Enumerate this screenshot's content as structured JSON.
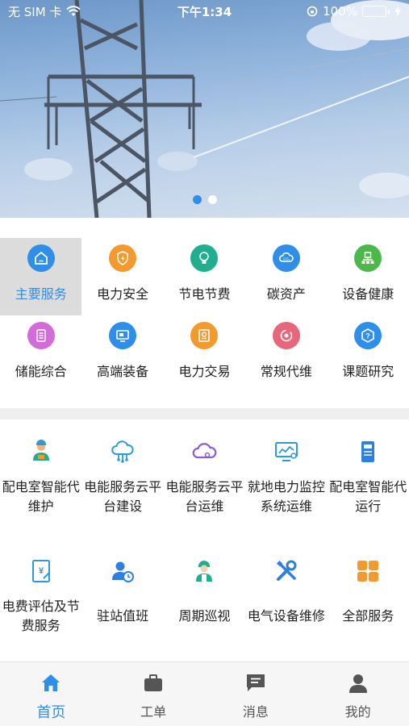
{
  "status_bar": {
    "carrier": "无 SIM 卡",
    "time": "下午1:34",
    "battery": "100%",
    "wifi_icon": "wifi-icon",
    "charging_icon": "charging-icon",
    "lock_icon": "orientation-lock-icon"
  },
  "banner": {
    "image": "power-transmission-tower-photo",
    "page_count": 2,
    "active_page": 1
  },
  "categories": [
    {
      "label": "主要服务",
      "icon": "home-icon",
      "color": "#2f8ee8",
      "selected": true
    },
    {
      "label": "电力安全",
      "icon": "lightning-shield-icon",
      "color": "#f39a2e"
    },
    {
      "label": "节电节费",
      "icon": "bulb-icon",
      "color": "#1fae8e"
    },
    {
      "label": "碳资产",
      "icon": "co2-cloud-icon",
      "color": "#2f8ee8"
    },
    {
      "label": "设备健康",
      "icon": "device-network-icon",
      "color": "#4cb84a"
    },
    {
      "label": "储能综合",
      "icon": "battery-storage-icon",
      "color": "#d36bd8"
    },
    {
      "label": "高端装备",
      "icon": "equipment-icon",
      "color": "#2f8ee8"
    },
    {
      "label": "电力交易",
      "icon": "trade-icon",
      "color": "#f39a2e"
    },
    {
      "label": "常规代维",
      "icon": "maintenance-cycle-icon",
      "color": "#e8667a"
    },
    {
      "label": "课题研究",
      "icon": "research-question-icon",
      "color": "#2f8ee8"
    }
  ],
  "services": [
    {
      "label": "配电室智能代维护",
      "icon": "engineer-icon",
      "color": "#2e9bd6"
    },
    {
      "label": "电能服务云平台建设",
      "icon": "cloud-network-icon",
      "color": "#2e9bd6"
    },
    {
      "label": "电能服务云平台运维",
      "icon": "cloud-icon",
      "color": "#8e5bd6"
    },
    {
      "label": "就地电力监控系统运维",
      "icon": "monitor-chart-icon",
      "color": "#2e9bd6"
    },
    {
      "label": "配电室智能代运行",
      "icon": "meter-icon",
      "color": "#2e7fe0"
    },
    {
      "label": "电费评估及节费服务",
      "icon": "fee-document-icon",
      "color": "#2e9bd6"
    },
    {
      "label": "驻站值班",
      "icon": "duty-person-clock-icon",
      "color": "#2e7fe0"
    },
    {
      "label": "周期巡视",
      "icon": "inspector-icon",
      "color": "#1fae8e"
    },
    {
      "label": "电气设备维修",
      "icon": "tools-icon",
      "color": "#2e7fe0"
    },
    {
      "label": "全部服务",
      "icon": "grid-apps-icon",
      "color": "#f39a2e"
    }
  ],
  "tabs": [
    {
      "label": "首页",
      "icon": "home-icon",
      "active": true
    },
    {
      "label": "工单",
      "icon": "briefcase-icon"
    },
    {
      "label": "消息",
      "icon": "message-icon"
    },
    {
      "label": "我的",
      "icon": "person-icon"
    }
  ],
  "colors": {
    "accent": "#2f8ee8",
    "inactive_tab": "#555555"
  }
}
